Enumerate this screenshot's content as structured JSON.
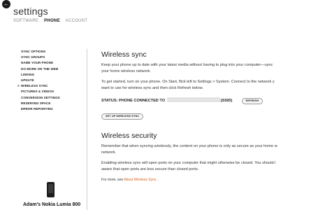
{
  "app": {
    "title": "settings"
  },
  "tabs": [
    {
      "label": "SOFTWARE",
      "active": false
    },
    {
      "label": "PHONE",
      "active": true
    },
    {
      "label": "ACCOUNT",
      "active": false
    }
  ],
  "sidebar": {
    "items": [
      {
        "label": "SYNC OPTIONS"
      },
      {
        "label": "SYNC GROUPS"
      },
      {
        "label": "NAME YOUR PHONE"
      },
      {
        "label": "DO MORE ON THE WEB"
      },
      {
        "label": "LINKING"
      },
      {
        "label": "UPDATE"
      },
      {
        "label": "WIRELESS SYNC",
        "selected": true
      },
      {
        "label": "PICTURES & VIDEOS"
      },
      {
        "label": "CONVERSION SETTINGS"
      },
      {
        "label": "RESERVED SPACE"
      },
      {
        "label": "ERROR REPORTING"
      }
    ],
    "selected_marker": "»",
    "phone_name": "Adam's Nokia Lumia 800"
  },
  "wireless_sync": {
    "heading": "Wireless sync",
    "para1_line1": "Keep your phone up to date with your latest media without having to plug into your computer—sync",
    "para1_line2": "your home wireless network.",
    "para2_line1": "To get started, turn on your phone. On Start, flick left to Settings > System. Connect to the network y",
    "para2_line2": "want to use for wireless sync and then click Refresh below.",
    "status_label": "STATUS: PHONE CONNECTED TO",
    "ssid_suffix": "(SSID)",
    "refresh_button": "REFRESH",
    "setup_button": "SET UP WIRELESS SYNC"
  },
  "wireless_security": {
    "heading": "Wireless security",
    "para1_line1": "Remember that when syncing wirelessly, the content on your phone is only as secure as your home w",
    "para1_line2": "network.",
    "para2_line1": "Enabling wireless sync will open ports on your computer that might otherwise be closed. You should l",
    "para2_line2": "aware that open ports are less secure than closed ports.",
    "more_prefix": "For more, see",
    "more_link": "About Wireless Sync",
    "more_suffix": "."
  },
  "colors": {
    "link": "#d9631e",
    "text": "#2b2b2b"
  },
  "icons": {
    "back": "back-arrow-icon",
    "phone": "phone-image"
  }
}
